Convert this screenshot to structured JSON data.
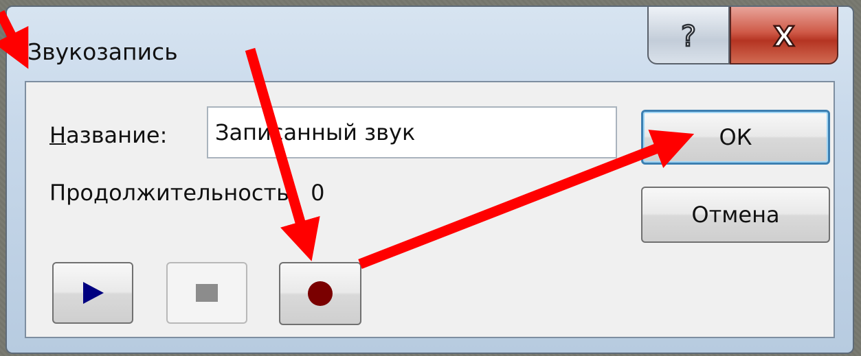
{
  "window": {
    "title": "Звукозапись",
    "help_glyph": "?",
    "close_glyph": "X"
  },
  "form": {
    "name_label_accel": "Н",
    "name_label_rest": "азвание:",
    "name_value": "Записанный звук",
    "duration_label": "Продолжительность:",
    "duration_value": "0"
  },
  "buttons": {
    "ok_label": "ОК",
    "cancel_label": "Отмена"
  },
  "icons": {
    "play": "play-icon",
    "stop": "stop-icon",
    "record": "record-icon",
    "help": "help-icon",
    "close": "close-icon"
  },
  "colors": {
    "play": "#000080",
    "stop_disabled": "#8c8c8c",
    "record": "#7a0000",
    "annotation": "#ff0000",
    "close_button": "#c43b28"
  }
}
